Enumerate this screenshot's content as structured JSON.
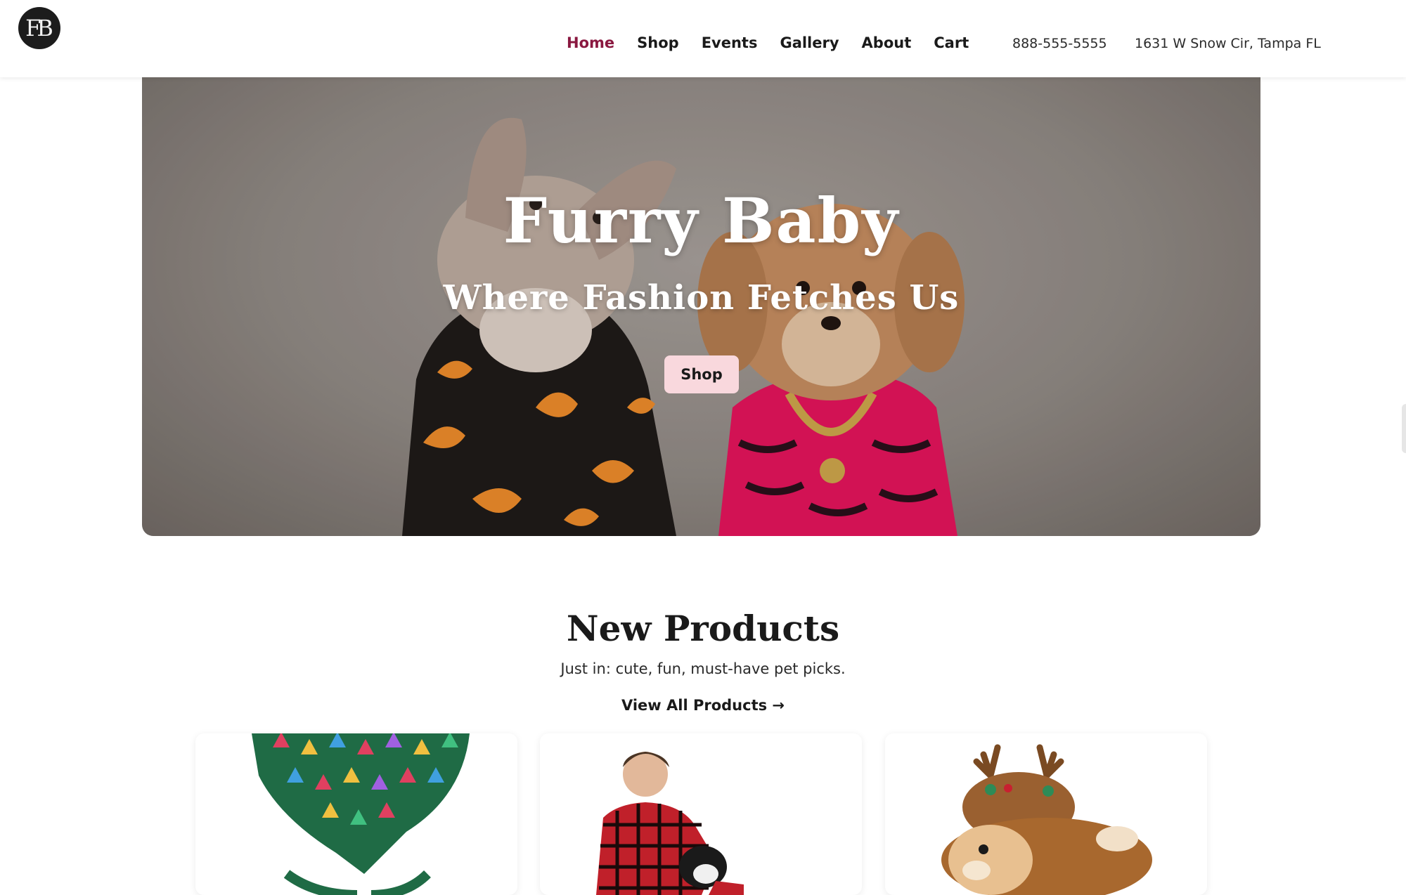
{
  "header": {
    "logo_text": "FB",
    "nav": {
      "home": "Home",
      "shop": "Shop",
      "events": "Events",
      "gallery": "Gallery",
      "about": "About",
      "cart": "Cart"
    },
    "phone": "888-555-5555",
    "address": "1631 W Snow Cir, Tampa FL"
  },
  "hero": {
    "title": "Furry Baby",
    "subtitle": "Where Fashion Fetches Us",
    "button_label": "Shop"
  },
  "new_products": {
    "title": "New Products",
    "subtitle": "Just in: cute, fun, must-have pet picks.",
    "view_all_label": "View All Products →"
  },
  "colors": {
    "accent": "#8a1840",
    "button_bg": "#f9d8dd",
    "logo_bg": "#1c1c1c"
  }
}
